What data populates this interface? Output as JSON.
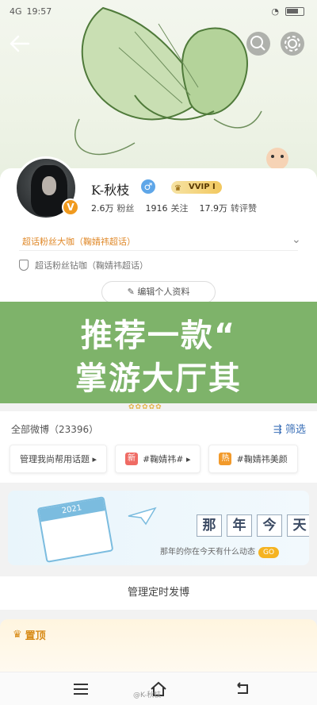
{
  "status": {
    "time": "19:57",
    "net": "4G"
  },
  "profile": {
    "name": "K-秋枝",
    "gender_symbol": "♂",
    "vip_label": "VVIP Ⅰ",
    "verified_symbol": "V",
    "stats": [
      {
        "value": "2.6万",
        "label": "粉丝"
      },
      {
        "value": "1916",
        "label": "关注"
      },
      {
        "value": "17.9万",
        "label": "转评赞"
      }
    ],
    "fan_title": "超话粉丝大咖（鞠婧祎超话）",
    "honor": "超话粉丝钻咖（鞠婧祎超话）",
    "edit_button": "编辑个人资料"
  },
  "overlay": {
    "line1": "推荐一款“",
    "line2": "掌游大厅其"
  },
  "feed": {
    "title": "全部微博（23396）",
    "filter": "筛选",
    "chips": [
      {
        "text": "管理我尚帮用话题 ▸",
        "tag": "",
        "tag_color": ""
      },
      {
        "text": "#鞠婧祎# ▸",
        "tag": "新",
        "tag_color": "#ef6b64"
      },
      {
        "text": "#鞠婧祎美颜",
        "tag": "热",
        "tag_color": "#f29a2b"
      }
    ]
  },
  "memory": {
    "calendar_year": "2021",
    "title_chars": [
      "那",
      "年",
      "今",
      "天"
    ],
    "subtitle": "那年的你在今天有什么动态",
    "go_label": "GO"
  },
  "manage": {
    "label": "管理定时发博"
  },
  "pinned": {
    "label": "置顶"
  },
  "watermark": "@K-秋枝",
  "colors": {
    "accent": "#3a6fb7",
    "overlay": "#7eb36a",
    "orange": "#e0892a"
  }
}
